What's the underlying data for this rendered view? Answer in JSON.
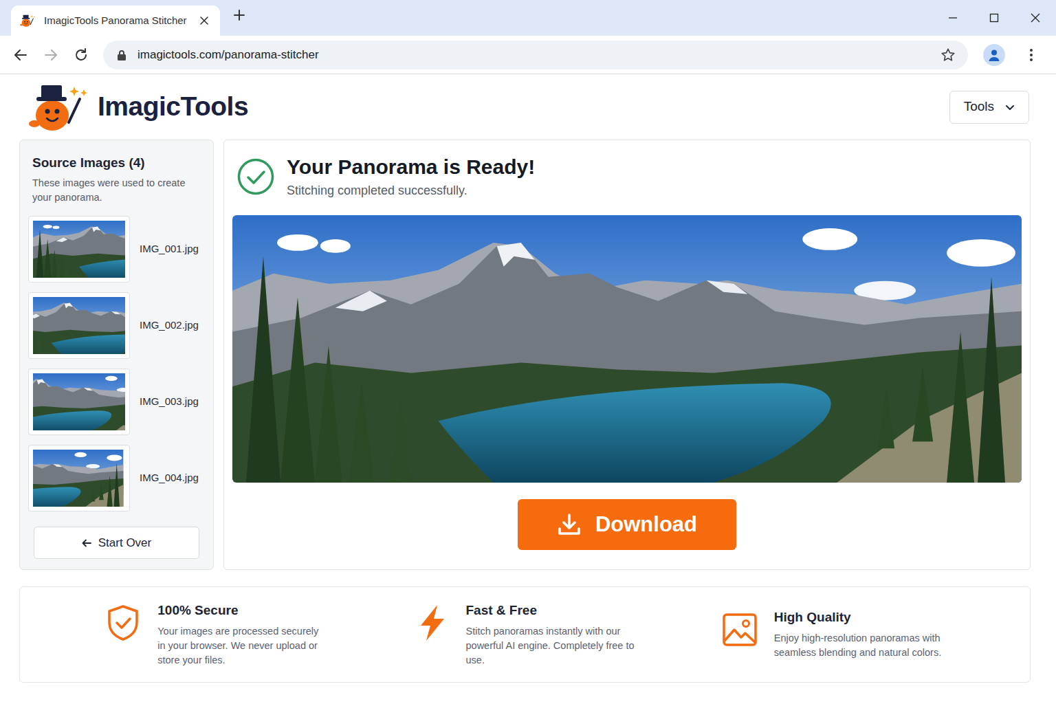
{
  "browser": {
    "tabs": [
      {
        "title": "ImagicTools Panorama Stitcher",
        "selected": true
      }
    ],
    "address": "imagictools.com/panorama-stitcher",
    "forward_disabled": true,
    "bookmarked": false
  },
  "header": {
    "brand": "ImagicTools",
    "tools_menu": {
      "label": "Tools",
      "expanded": false
    }
  },
  "sidebar": {
    "title": "Source Images (4)",
    "description": "These images were used to create your panorama.",
    "images": [
      {
        "name": "IMG_001.jpg"
      },
      {
        "name": "IMG_002.jpg"
      },
      {
        "name": "IMG_003.jpg"
      },
      {
        "name": "IMG_004.jpg"
      }
    ],
    "start_over": "Start Over"
  },
  "result": {
    "title": "Your Panorama is Ready!",
    "subtitle": "Stitching completed successfully.",
    "download": "Download"
  },
  "features": [
    {
      "kind": "shield",
      "title": "100% Secure",
      "text": "Your images are processed securely in your browser. We never upload or store your files."
    },
    {
      "kind": "bolt",
      "title": "Fast & Free",
      "text": "Stitch panoramas instantly with our powerful AI engine. Completely free to use."
    },
    {
      "kind": "image",
      "title": "High Quality",
      "text": "Enjoy high-resolution panoramas with seamless blending and natural colors."
    }
  ]
}
